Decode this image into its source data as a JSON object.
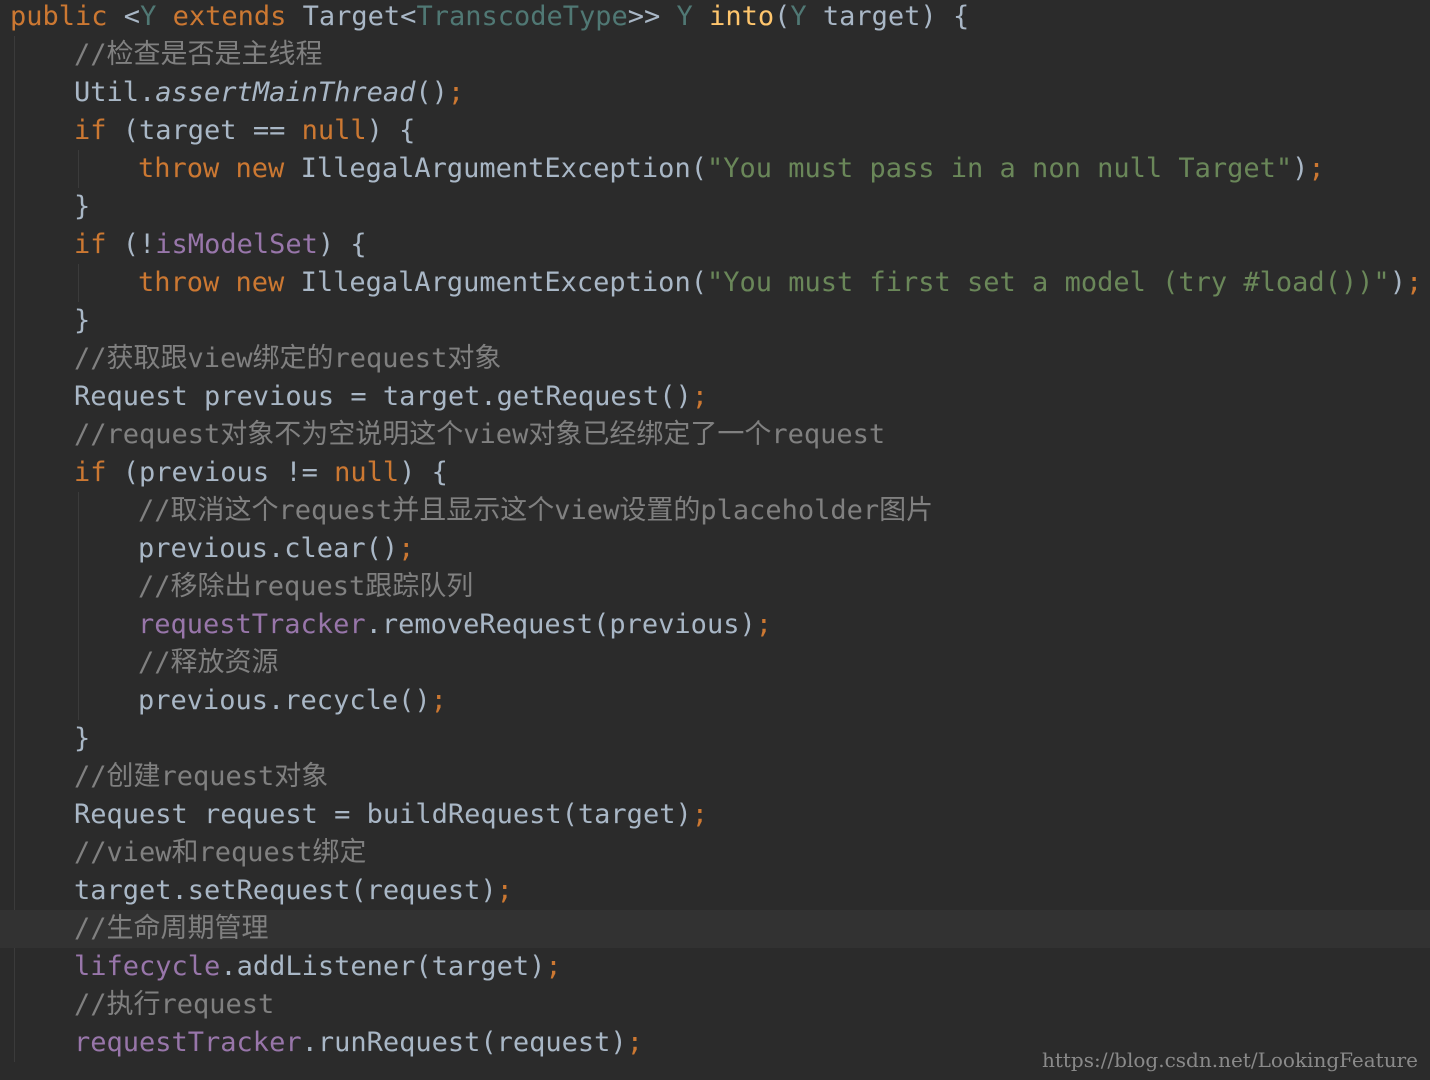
{
  "editor": {
    "theme_colors": {
      "background": "#2b2b2b",
      "current_line": "#323232",
      "keyword": "#cc7832",
      "string": "#6a8759",
      "comment": "#808080",
      "field": "#9876aa",
      "method_declaration": "#ffc66d",
      "type_parameter": "#507874",
      "plain": "#a9b7c6"
    },
    "lines": [
      {
        "indent": 0,
        "tokens": [
          {
            "t": "public",
            "k": "keyword"
          },
          {
            "t": " <",
            "k": "plain"
          },
          {
            "t": "Y",
            "k": "typeparam"
          },
          {
            "t": " ",
            "k": "plain"
          },
          {
            "t": "extends",
            "k": "keyword"
          },
          {
            "t": " Target<",
            "k": "plain"
          },
          {
            "t": "TranscodeType",
            "k": "typeparam"
          },
          {
            "t": ">> ",
            "k": "plain"
          },
          {
            "t": "Y",
            "k": "typeparam"
          },
          {
            "t": " ",
            "k": "plain"
          },
          {
            "t": "into",
            "k": "method-def"
          },
          {
            "t": "(",
            "k": "plain"
          },
          {
            "t": "Y",
            "k": "typeparam"
          },
          {
            "t": " target) {",
            "k": "plain"
          }
        ]
      },
      {
        "indent": 1,
        "tokens": [
          {
            "t": "//检查是否是主线程",
            "k": "comment"
          }
        ]
      },
      {
        "indent": 1,
        "tokens": [
          {
            "t": "Util.",
            "k": "plain"
          },
          {
            "t": "assertMainThread",
            "k": "plain",
            "italic": true
          },
          {
            "t": "()",
            "k": "plain"
          },
          {
            "t": ";",
            "k": "semicolon"
          }
        ]
      },
      {
        "indent": 1,
        "tokens": [
          {
            "t": "if",
            "k": "keyword"
          },
          {
            "t": " (target == ",
            "k": "plain"
          },
          {
            "t": "null",
            "k": "keyword"
          },
          {
            "t": ") {",
            "k": "plain"
          }
        ]
      },
      {
        "indent": 2,
        "tokens": [
          {
            "t": "throw new",
            "k": "keyword"
          },
          {
            "t": " IllegalArgumentException(",
            "k": "plain"
          },
          {
            "t": "\"You must pass in a non null Target\"",
            "k": "string"
          },
          {
            "t": ")",
            "k": "plain"
          },
          {
            "t": ";",
            "k": "semicolon"
          }
        ]
      },
      {
        "indent": 1,
        "tokens": [
          {
            "t": "}",
            "k": "plain"
          }
        ]
      },
      {
        "indent": 1,
        "tokens": [
          {
            "t": "if",
            "k": "keyword"
          },
          {
            "t": " (!",
            "k": "plain"
          },
          {
            "t": "isModelSet",
            "k": "field"
          },
          {
            "t": ") {",
            "k": "plain"
          }
        ]
      },
      {
        "indent": 2,
        "tokens": [
          {
            "t": "throw new",
            "k": "keyword"
          },
          {
            "t": " IllegalArgumentException(",
            "k": "plain"
          },
          {
            "t": "\"You must first set a model (try #load())\"",
            "k": "string"
          },
          {
            "t": ")",
            "k": "plain"
          },
          {
            "t": ";",
            "k": "semicolon"
          }
        ]
      },
      {
        "indent": 1,
        "tokens": [
          {
            "t": "}",
            "k": "plain"
          }
        ]
      },
      {
        "indent": 1,
        "tokens": [
          {
            "t": "//获取跟view绑定的request对象",
            "k": "comment"
          }
        ]
      },
      {
        "indent": 1,
        "tokens": [
          {
            "t": "Request previous = target.getRequest()",
            "k": "plain"
          },
          {
            "t": ";",
            "k": "semicolon"
          }
        ]
      },
      {
        "indent": 1,
        "tokens": [
          {
            "t": "//request对象不为空说明这个view对象已经绑定了一个request",
            "k": "comment"
          }
        ]
      },
      {
        "indent": 1,
        "tokens": [
          {
            "t": "if",
            "k": "keyword"
          },
          {
            "t": " (previous != ",
            "k": "plain"
          },
          {
            "t": "null",
            "k": "keyword"
          },
          {
            "t": ") {",
            "k": "plain"
          }
        ]
      },
      {
        "indent": 2,
        "tokens": [
          {
            "t": "//取消这个request并且显示这个view设置的placeholder图片",
            "k": "comment"
          }
        ]
      },
      {
        "indent": 2,
        "tokens": [
          {
            "t": "previous.clear()",
            "k": "plain"
          },
          {
            "t": ";",
            "k": "semicolon"
          }
        ]
      },
      {
        "indent": 2,
        "tokens": [
          {
            "t": "//移除出request跟踪队列",
            "k": "comment"
          }
        ]
      },
      {
        "indent": 2,
        "tokens": [
          {
            "t": "requestTracker",
            "k": "field"
          },
          {
            "t": ".removeRequest(previous)",
            "k": "plain"
          },
          {
            "t": ";",
            "k": "semicolon"
          }
        ]
      },
      {
        "indent": 2,
        "tokens": [
          {
            "t": "//释放资源",
            "k": "comment"
          }
        ]
      },
      {
        "indent": 2,
        "tokens": [
          {
            "t": "previous.recycle()",
            "k": "plain"
          },
          {
            "t": ";",
            "k": "semicolon"
          }
        ]
      },
      {
        "indent": 1,
        "tokens": [
          {
            "t": "}",
            "k": "plain"
          }
        ]
      },
      {
        "indent": 1,
        "tokens": [
          {
            "t": "//创建request对象",
            "k": "comment"
          }
        ]
      },
      {
        "indent": 1,
        "tokens": [
          {
            "t": "Request request = buildRequest(target)",
            "k": "plain"
          },
          {
            "t": ";",
            "k": "semicolon"
          }
        ]
      },
      {
        "indent": 1,
        "tokens": [
          {
            "t": "//view和request绑定",
            "k": "comment"
          }
        ]
      },
      {
        "indent": 1,
        "tokens": [
          {
            "t": "target.setRequest(request)",
            "k": "plain"
          },
          {
            "t": ";",
            "k": "semicolon"
          }
        ]
      },
      {
        "indent": 1,
        "current": true,
        "tokens": [
          {
            "t": "//生命周期管理",
            "k": "comment"
          }
        ]
      },
      {
        "indent": 1,
        "tokens": [
          {
            "t": "lifecycle",
            "k": "field"
          },
          {
            "t": ".addListener(target)",
            "k": "plain"
          },
          {
            "t": ";",
            "k": "semicolon"
          }
        ]
      },
      {
        "indent": 1,
        "tokens": [
          {
            "t": "//执行request",
            "k": "comment"
          }
        ]
      },
      {
        "indent": 1,
        "tokens": [
          {
            "t": "requestTracker",
            "k": "field"
          },
          {
            "t": ".runRequest(request)",
            "k": "plain"
          },
          {
            "t": ";",
            "k": "semicolon"
          }
        ]
      }
    ]
  },
  "watermark": {
    "text": "https://blog.csdn.net/LookingFeature"
  }
}
